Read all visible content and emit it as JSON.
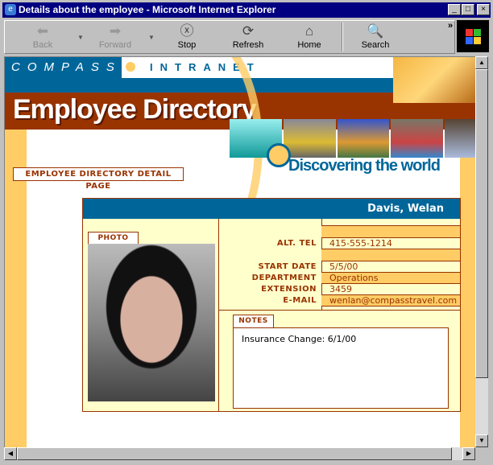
{
  "window": {
    "title": "Details about the employee - Microsoft Internet Explorer",
    "controls": [
      "_",
      "□",
      "×"
    ]
  },
  "toolbar": {
    "buttons": [
      {
        "label": "Back",
        "icon": "back-arrow-icon",
        "enabled": false
      },
      {
        "label": "Forward",
        "icon": "forward-arrow-icon",
        "enabled": false
      },
      {
        "label": "Stop",
        "icon": "stop-icon",
        "enabled": true
      },
      {
        "label": "Refresh",
        "icon": "refresh-icon",
        "enabled": true
      },
      {
        "label": "Home",
        "icon": "home-icon",
        "enabled": true
      },
      {
        "label": "Search",
        "icon": "search-icon",
        "enabled": true
      }
    ],
    "more": "»"
  },
  "header": {
    "logo": "COMPASS",
    "intranet": "INTRANET",
    "title": "Employee Directory",
    "tagline": "Discovering the world",
    "page_label": "EMPLOYEE DIRECTORY DETAIL PAGE"
  },
  "employee": {
    "name": "Davis, Welan",
    "photo_label": "PHOTO I.D.",
    "fields": [
      {
        "label": "ALT. TEL",
        "value": "415-555-1214"
      },
      {
        "label": "START DATE",
        "value": "5/5/00"
      },
      {
        "label": "DEPARTMENT",
        "value": "Operations"
      },
      {
        "label": "EXTENSION",
        "value": "3459"
      },
      {
        "label": "E-MAIL",
        "value": "wenlan@compasstravel.com"
      }
    ],
    "notes_label": "NOTES",
    "notes": "Insurance Change: 6/1/00"
  },
  "colors": {
    "blue": "#006699",
    "brown": "#993300",
    "orange": "#ffcc66",
    "cream": "#ffffcc"
  }
}
